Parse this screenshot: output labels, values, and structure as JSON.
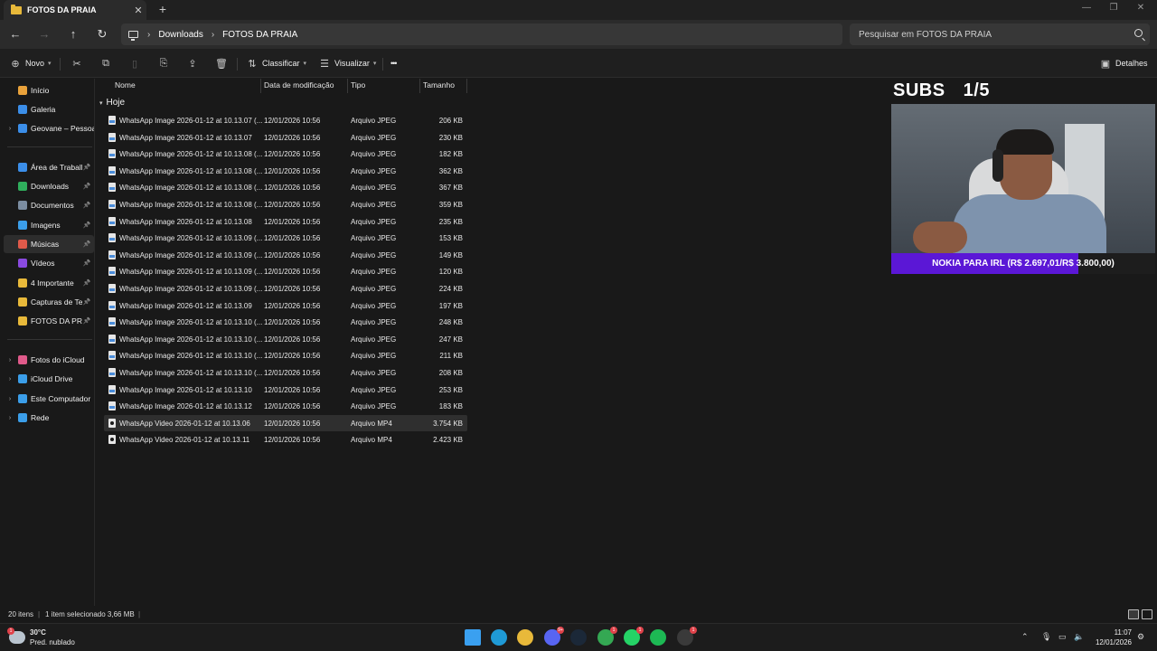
{
  "window": {
    "tab_title": "FOTOS DA PRAIA",
    "tab_close": "✕",
    "new_tab": "+",
    "minimize": "—",
    "maximize": "❐",
    "close": "✕"
  },
  "nav": {
    "back": "←",
    "forward": "→",
    "up": "↑",
    "refresh": "↻",
    "breadcrumb": [
      "Downloads",
      "FOTOS DA PRAIA"
    ],
    "breadcrumb_sep": "›",
    "search_placeholder": "Pesquisar em FOTOS DA PRAIA"
  },
  "toolbar": {
    "new_label": "Novo",
    "sort_label": "Classificar",
    "view_label": "Visualizar",
    "more": "•••",
    "details_label": "Detalhes"
  },
  "sidebar": {
    "items": [
      {
        "label": "Início",
        "icon": "home-icon",
        "color": "#e9a23b"
      },
      {
        "label": "Galeria",
        "icon": "gallery-icon",
        "color": "#3b8ee9"
      },
      {
        "label": "Geovane – Pessoal",
        "icon": "onedrive-icon",
        "color": "#3b8ee9",
        "expandable": true
      },
      {
        "label": "Área de Trabalho",
        "icon": "desktop-icon",
        "color": "#3b8ee9",
        "pinned": true
      },
      {
        "label": "Downloads",
        "icon": "download-icon",
        "color": "#2fae5c",
        "pinned": true
      },
      {
        "label": "Documentos",
        "icon": "documents-icon",
        "color": "#7b8da1",
        "pinned": true
      },
      {
        "label": "Imagens",
        "icon": "pictures-icon",
        "color": "#3b9ee9",
        "pinned": true
      },
      {
        "label": "Músicas",
        "icon": "music-icon",
        "color": "#e05a4a",
        "pinned": true,
        "selected": true
      },
      {
        "label": "Vídeos",
        "icon": "videos-icon",
        "color": "#8a4ae0",
        "pinned": true
      },
      {
        "label": "4 Importante",
        "icon": "folder-icon",
        "color": "#e8b93a",
        "pinned": true
      },
      {
        "label": "Capturas de Tela",
        "icon": "folder-icon",
        "color": "#e8b93a",
        "pinned": true
      },
      {
        "label": "FOTOS DA PRAIA",
        "icon": "folder-icon",
        "color": "#e8b93a",
        "pinned": true
      },
      {
        "label": "Fotos do iCloud",
        "icon": "icloud-photos-icon",
        "color": "#e05a8a",
        "expandable": true
      },
      {
        "label": "iCloud Drive",
        "icon": "icloud-icon",
        "color": "#3b9ee9",
        "expandable": true
      },
      {
        "label": "Este Computador",
        "icon": "computer-icon",
        "color": "#3b9ee9",
        "expandable": true
      },
      {
        "label": "Rede",
        "icon": "network-icon",
        "color": "#3b9ee9",
        "expandable": true
      }
    ]
  },
  "columns": {
    "name": "Nome",
    "modified": "Data de modificação",
    "type": "Tipo",
    "size": "Tamanho"
  },
  "group_label": "Hoje",
  "files": [
    {
      "name": "WhatsApp Image 2026-01-12 at 10.13.07 (...",
      "date": "12/01/2026 10:56",
      "type": "Arquivo JPEG",
      "size": "206 KB",
      "kind": "img"
    },
    {
      "name": "WhatsApp Image 2026-01-12 at 10.13.07",
      "date": "12/01/2026 10:56",
      "type": "Arquivo JPEG",
      "size": "230 KB",
      "kind": "img"
    },
    {
      "name": "WhatsApp Image 2026-01-12 at 10.13.08 (...",
      "date": "12/01/2026 10:56",
      "type": "Arquivo JPEG",
      "size": "182 KB",
      "kind": "img"
    },
    {
      "name": "WhatsApp Image 2026-01-12 at 10.13.08 (...",
      "date": "12/01/2026 10:56",
      "type": "Arquivo JPEG",
      "size": "362 KB",
      "kind": "img"
    },
    {
      "name": "WhatsApp Image 2026-01-12 at 10.13.08 (...",
      "date": "12/01/2026 10:56",
      "type": "Arquivo JPEG",
      "size": "367 KB",
      "kind": "img"
    },
    {
      "name": "WhatsApp Image 2026-01-12 at 10.13.08 (...",
      "date": "12/01/2026 10:56",
      "type": "Arquivo JPEG",
      "size": "359 KB",
      "kind": "img"
    },
    {
      "name": "WhatsApp Image 2026-01-12 at 10.13.08",
      "date": "12/01/2026 10:56",
      "type": "Arquivo JPEG",
      "size": "235 KB",
      "kind": "img"
    },
    {
      "name": "WhatsApp Image 2026-01-12 at 10.13.09 (...",
      "date": "12/01/2026 10:56",
      "type": "Arquivo JPEG",
      "size": "153 KB",
      "kind": "img"
    },
    {
      "name": "WhatsApp Image 2026-01-12 at 10.13.09 (...",
      "date": "12/01/2026 10:56",
      "type": "Arquivo JPEG",
      "size": "149 KB",
      "kind": "img"
    },
    {
      "name": "WhatsApp Image 2026-01-12 at 10.13.09 (...",
      "date": "12/01/2026 10:56",
      "type": "Arquivo JPEG",
      "size": "120 KB",
      "kind": "img"
    },
    {
      "name": "WhatsApp Image 2026-01-12 at 10.13.09 (...",
      "date": "12/01/2026 10:56",
      "type": "Arquivo JPEG",
      "size": "224 KB",
      "kind": "img"
    },
    {
      "name": "WhatsApp Image 2026-01-12 at 10.13.09",
      "date": "12/01/2026 10:56",
      "type": "Arquivo JPEG",
      "size": "197 KB",
      "kind": "img"
    },
    {
      "name": "WhatsApp Image 2026-01-12 at 10.13.10 (...",
      "date": "12/01/2026 10:56",
      "type": "Arquivo JPEG",
      "size": "248 KB",
      "kind": "img"
    },
    {
      "name": "WhatsApp Image 2026-01-12 at 10.13.10 (...",
      "date": "12/01/2026 10:56",
      "type": "Arquivo JPEG",
      "size": "247 KB",
      "kind": "img"
    },
    {
      "name": "WhatsApp Image 2026-01-12 at 10.13.10 (...",
      "date": "12/01/2026 10:56",
      "type": "Arquivo JPEG",
      "size": "211 KB",
      "kind": "img"
    },
    {
      "name": "WhatsApp Image 2026-01-12 at 10.13.10 (...",
      "date": "12/01/2026 10:56",
      "type": "Arquivo JPEG",
      "size": "208 KB",
      "kind": "img"
    },
    {
      "name": "WhatsApp Image 2026-01-12 at 10.13.10",
      "date": "12/01/2026 10:56",
      "type": "Arquivo JPEG",
      "size": "253 KB",
      "kind": "img"
    },
    {
      "name": "WhatsApp Image 2026-01-12 at 10.13.12",
      "date": "12/01/2026 10:56",
      "type": "Arquivo JPEG",
      "size": "183 KB",
      "kind": "img"
    },
    {
      "name": "WhatsApp Video 2026-01-12 at 10.13.06",
      "date": "12/01/2026 10:56",
      "type": "Arquivo MP4",
      "size": "3.754 KB",
      "kind": "vid",
      "selected": true
    },
    {
      "name": "WhatsApp Video 2026-01-12 at 10.13.11",
      "date": "12/01/2026 10:56",
      "type": "Arquivo MP4",
      "size": "2.423 KB",
      "kind": "vid"
    }
  ],
  "status": {
    "count": "20 itens",
    "selection": "1 item selecionado 3,66 MB"
  },
  "overlay": {
    "subs_label": "SUBS",
    "subs_value": "1/5",
    "goal_text": "NOKIA PARA IRL (R$ 2.697,01/R$ 3.800,00)",
    "goal_progress": 0.7097,
    "goal_color": "#5b17d6"
  },
  "taskbar": {
    "temp": "30°C",
    "weather": "Pred. nublado",
    "weather_badge": "1",
    "time": "11:07",
    "date": "12/01/2026",
    "apps": [
      {
        "name": "windows-start-icon",
        "color": "#3aa0f0",
        "badge": ""
      },
      {
        "name": "edge-icon",
        "color": "#1f9ad6",
        "badge": ""
      },
      {
        "name": "file-explorer-icon",
        "color": "#e8b93a",
        "badge": ""
      },
      {
        "name": "discord-icon",
        "color": "#5865f2",
        "badge": "9+"
      },
      {
        "name": "steam-icon",
        "color": "#1b2838",
        "badge": ""
      },
      {
        "name": "chrome-icon",
        "color": "#34a853",
        "badge": "1"
      },
      {
        "name": "whatsapp-icon",
        "color": "#25d366",
        "badge": "1"
      },
      {
        "name": "spotify-icon",
        "color": "#1db954",
        "badge": ""
      },
      {
        "name": "obs-icon",
        "color": "#3a3a3a",
        "badge": "1"
      }
    ]
  }
}
